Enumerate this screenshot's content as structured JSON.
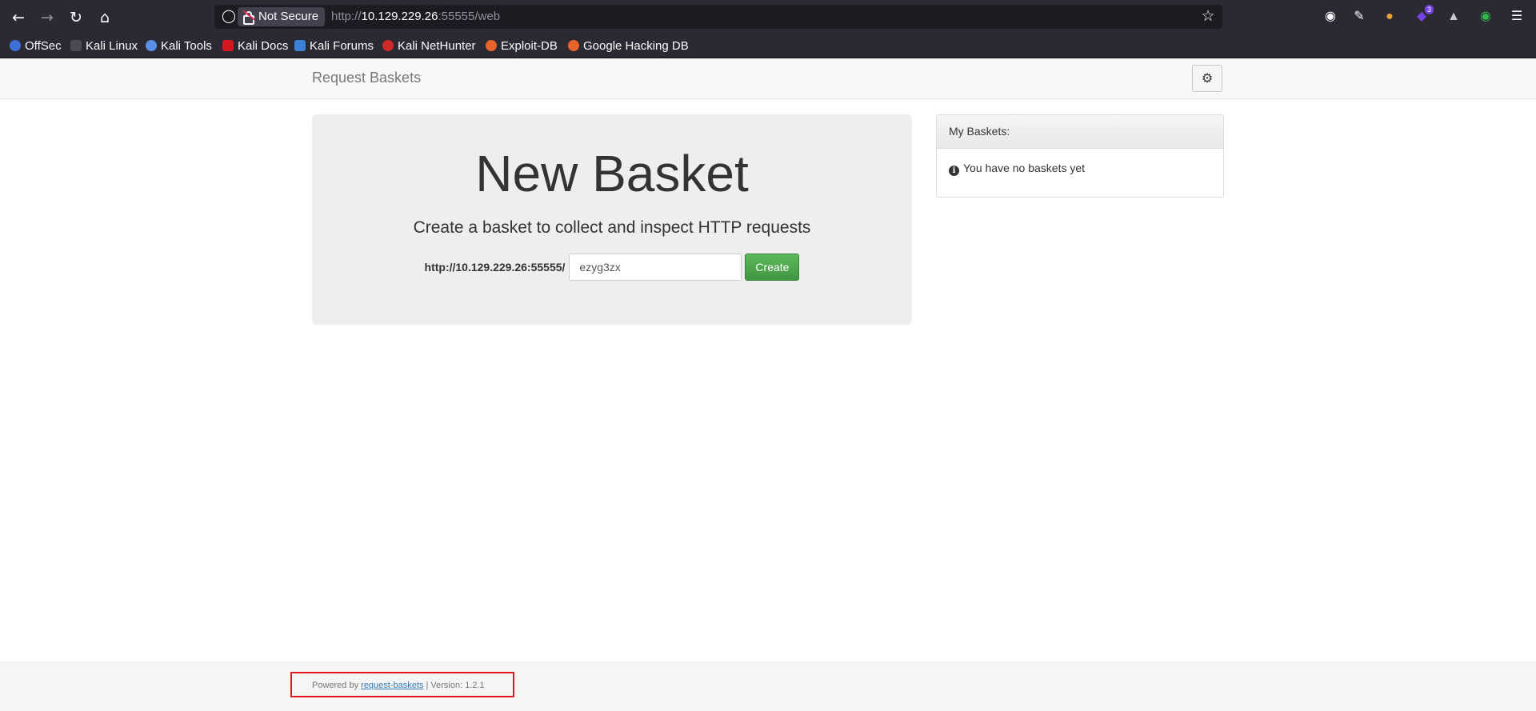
{
  "browser": {
    "url_prefix": "http://",
    "url_host": "10.129.229.26",
    "url_suffix": ":55555/web",
    "security_label": "Not Secure",
    "extension_badge": "3",
    "bookmarks": [
      {
        "label": "OffSec",
        "icon_color": "#3f6fd8"
      },
      {
        "label": "Kali Linux",
        "icon_color": "#2b2a33"
      },
      {
        "label": "Kali Tools",
        "icon_color": "#5a8fe8"
      },
      {
        "label": "Kali Docs",
        "icon_color": "#d4181f"
      },
      {
        "label": "Kali Forums",
        "icon_color": "#3b82d6"
      },
      {
        "label": "Kali NetHunter",
        "icon_color": "#d12a2a"
      },
      {
        "label": "Exploit-DB",
        "icon_color": "#e8632b"
      },
      {
        "label": "Google Hacking DB",
        "icon_color": "#e8632b"
      }
    ]
  },
  "navbar": {
    "brand": "Request Baskets"
  },
  "main": {
    "title": "New Basket",
    "subtitle": "Create a basket to collect and inspect HTTP requests",
    "base_url": "http://10.129.229.26:55555/",
    "basket_name_value": "ezyg3zx",
    "create_label": "Create"
  },
  "my_baskets": {
    "heading": "My Baskets:",
    "empty_text": "You have no baskets yet"
  },
  "footer": {
    "powered_by": "Powered by",
    "link_text": "request-baskets",
    "version_text": "| Version: 1.2.1"
  },
  "colors": {
    "create_button": "#449d44",
    "highlight_box": "#e8121e"
  }
}
